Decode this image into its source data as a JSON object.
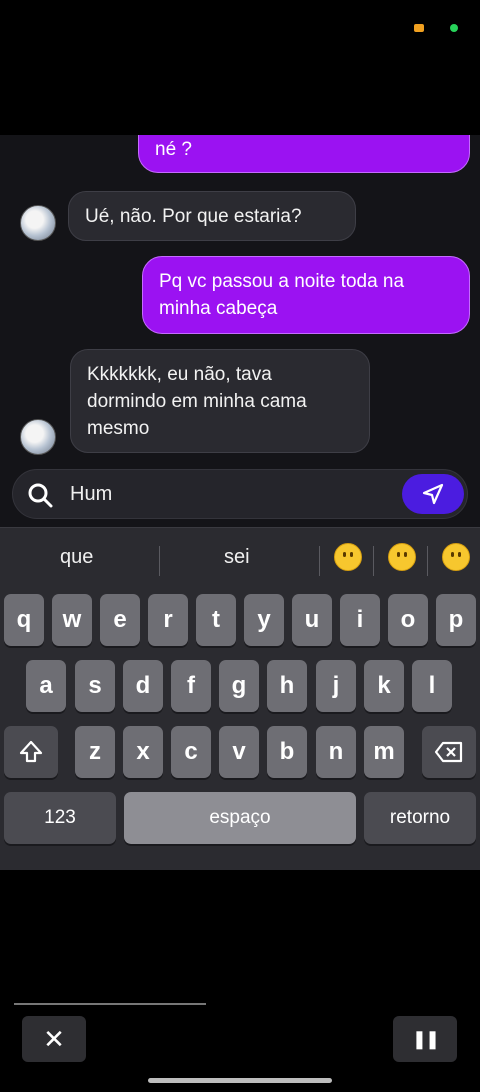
{
  "status": {
    "indicators": [
      "orange-indicator",
      "green-indicator"
    ]
  },
  "messages": [
    {
      "side": "out",
      "text": "né ?"
    },
    {
      "side": "in",
      "text": "Ué, não. Por que estaria?"
    },
    {
      "side": "out",
      "line1": "Pq vc passou a noite toda na",
      "line2": "minha cabeça"
    },
    {
      "side": "in",
      "line1": "Kkkkkkk, eu não, tava",
      "line2": "dormindo em minha cama",
      "line3": "mesmo"
    }
  ],
  "input": {
    "value": "Hum",
    "icon": "search-icon",
    "send_icon": "send-icon"
  },
  "keyboard": {
    "suggestions": [
      "que",
      "sei"
    ],
    "emojis": [
      "slightly-frowning-emoji",
      "face-with-monocle-emoji",
      "neutral-face-emoji"
    ],
    "row1": [
      "q",
      "w",
      "e",
      "r",
      "t",
      "y",
      "u",
      "i",
      "o",
      "p"
    ],
    "row2": [
      "a",
      "s",
      "d",
      "f",
      "g",
      "h",
      "j",
      "k",
      "l"
    ],
    "row3": [
      "z",
      "x",
      "c",
      "v",
      "b",
      "n",
      "m"
    ],
    "numbers_label": "123",
    "space_label": "espaço",
    "return_label": "retorno"
  },
  "player": {
    "close_label": "✕",
    "pause_label": "❚❚",
    "progress": 0.4
  }
}
